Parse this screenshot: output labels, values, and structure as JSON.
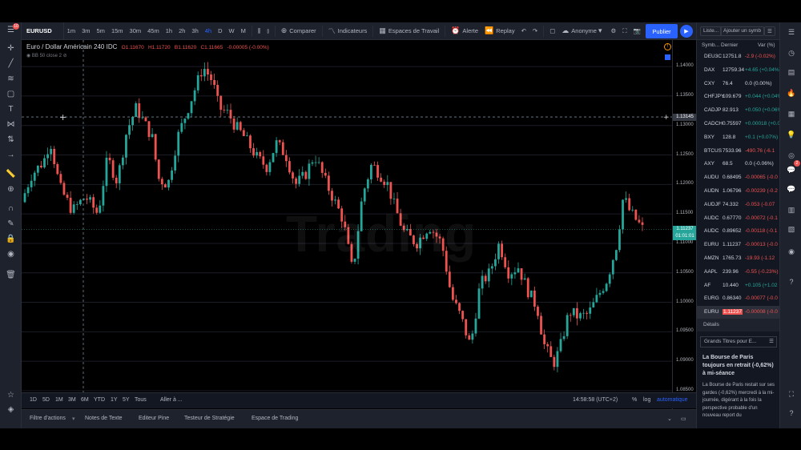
{
  "toolbar": {
    "symbol": "EURUSD",
    "intervals": [
      "1m",
      "3m",
      "5m",
      "15m",
      "30m",
      "45m",
      "1h",
      "2h",
      "3h",
      "4h",
      "D",
      "W",
      "M"
    ],
    "active_interval": "4h",
    "compare": "Comparer",
    "indicators": "Indicateurs",
    "workspaces": "Espaces de Travail",
    "alert": "Alerte",
    "replay": "Replay",
    "account": "Anonyme",
    "publish": "Publier"
  },
  "legend": {
    "title": "Euro / Dollar Américain  240  IDC",
    "open": "O1.11670",
    "high": "H1.11720",
    "low": "B1.11620",
    "close": "C1.11665",
    "change": "-0.00005 (-0.00%)",
    "indicator": "BB  50 close 2"
  },
  "watermark": "Trading",
  "price_axis": {
    "ticks": [
      "1.14000",
      "1.13500",
      "1.13000",
      "1.12500",
      "1.12000",
      "1.11500",
      "1.11000",
      "1.10500",
      "1.10000",
      "1.09500",
      "1.09000",
      "1.08500"
    ],
    "crosshair_price": "1.13145",
    "last_price": "1.11237",
    "countdown": "01:01:01"
  },
  "time_axis": {
    "ticks": [
      "13",
      "Juin",
      "17",
      "Juill",
      "15",
      "12:00",
      "Août",
      "12",
      "21",
      "Sept",
      "16",
      "Oct",
      "14",
      "23"
    ],
    "crosshair_time": "20 Mai '19  20:00"
  },
  "bottom": {
    "ranges": [
      "1D",
      "5D",
      "1M",
      "3M",
      "6M",
      "YTD",
      "1Y",
      "5Y",
      "Tous"
    ],
    "goto": "Aller à ...",
    "clock": "14:58:58 (UTC+2)",
    "percent": "%",
    "log": "log",
    "auto": "automatique"
  },
  "panels": [
    "Filtre d'actions",
    "Notes de Texte",
    "Editeur Pine",
    "Testeur de Stratégie",
    "Espace de Trading"
  ],
  "watchlist": {
    "tab1": "Liste...",
    "tab2": "Ajouter un symb",
    "col_symbol": "Symb...",
    "col_last": "Dernier",
    "col_chg": "Var (%)",
    "rows": [
      {
        "sym": "DEU3C",
        "last": "12751.8",
        "chg": "-2.9 (-0.02%)",
        "dir": "dn"
      },
      {
        "sym": "DAX",
        "last": "12759.34",
        "chg": "+4.65 (+0.04%)",
        "dir": "up"
      },
      {
        "sym": "CXY",
        "last": "76.4",
        "chg": "0.0 (0.00%)",
        "dir": "neu"
      },
      {
        "sym": "CHFJPY",
        "last": "109.679",
        "chg": "+0.044 (+0.04%)",
        "dir": "up"
      },
      {
        "sym": "CADJP",
        "last": "82.913",
        "chg": "+0.050 (+0.06%)",
        "dir": "up"
      },
      {
        "sym": "CADCH",
        "last": "0.75597",
        "chg": "+0.00018 (+0.0",
        "dir": "up"
      },
      {
        "sym": "BXY",
        "last": "128.8",
        "chg": "+0.1 (+0.07%)",
        "dir": "up"
      },
      {
        "sym": "BTCUS",
        "last": "7533.96",
        "chg": "-490.76 (-6.1",
        "dir": "dn"
      },
      {
        "sym": "AXY",
        "last": "68.5",
        "chg": "0.0 (-0.06%)",
        "dir": "neu"
      },
      {
        "sym": "AUDU",
        "last": "0.68495",
        "chg": "-0.00065 (-0.0",
        "dir": "dn"
      },
      {
        "sym": "AUDN",
        "last": "1.06796",
        "chg": "-0.00239 (-0.2",
        "dir": "dn"
      },
      {
        "sym": "AUDJF",
        "last": "74.332",
        "chg": "-0.053 (-0.07",
        "dir": "dn"
      },
      {
        "sym": "AUDC",
        "last": "0.67770",
        "chg": "-0.00072 (-0.1",
        "dir": "dn"
      },
      {
        "sym": "AUDC",
        "last": "0.89652",
        "chg": "-0.00118 (-0.1",
        "dir": "dn"
      },
      {
        "sym": "EURU",
        "last": "1.11237",
        "chg": "-0.00013 (-0.0",
        "dir": "dn"
      },
      {
        "sym": "AMZN",
        "last": "1765.73",
        "chg": "-19.93 (-1.12",
        "dir": "dn"
      },
      {
        "sym": "AAPL",
        "last": "239.96",
        "chg": "-0.55 (-0.23%)",
        "dir": "dn"
      },
      {
        "sym": "AF",
        "last": "10.440",
        "chg": "+0.105 (+1.02",
        "dir": "up"
      },
      {
        "sym": "EURG",
        "last": "0.86340",
        "chg": "-0.00077 (-0.0",
        "dir": "dn"
      },
      {
        "sym": "EURU",
        "last": "1.11237",
        "chg": "-0.00008 (-0.0",
        "dir": "dn"
      }
    ],
    "details": "Détails",
    "news_header": "Grands Titres pour E...",
    "news_title": "La Bourse de Paris toujours en retrait (-0,62%) à mi-séance",
    "news_body": "La Bourse de Paris restait sur ses gardes (-0,62%) mercredi à la mi-journée, digérant à la fois la perspective probable d'un nouveau report du"
  },
  "right_badge": "2",
  "notif_badge": "10",
  "colors": {
    "up": "#26a69a",
    "down": "#ef5350",
    "accent": "#2962ff",
    "background": "#000000"
  },
  "chart_data": {
    "type": "candlestick",
    "symbol": "EURUSD",
    "interval": "240",
    "ylim": [
      1.0835,
      1.1445
    ],
    "path": [
      [
        0,
        1.117
      ],
      [
        0.015,
        1.1215
      ],
      [
        0.035,
        1.124
      ],
      [
        0.045,
        1.1275
      ],
      [
        0.06,
        1.1195
      ],
      [
        0.08,
        1.1155
      ],
      [
        0.1,
        1.118
      ],
      [
        0.12,
        1.115
      ],
      [
        0.135,
        1.1245
      ],
      [
        0.15,
        1.1205
      ],
      [
        0.165,
        1.129
      ],
      [
        0.18,
        1.133
      ],
      [
        0.195,
        1.13
      ],
      [
        0.205,
        1.128
      ],
      [
        0.215,
        1.121
      ],
      [
        0.23,
        1.12
      ],
      [
        0.245,
        1.128
      ],
      [
        0.265,
        1.134
      ],
      [
        0.285,
        1.14
      ],
      [
        0.3,
        1.1375
      ],
      [
        0.31,
        1.133
      ],
      [
        0.325,
        1.132
      ],
      [
        0.335,
        1.13
      ],
      [
        0.35,
        1.128
      ],
      [
        0.37,
        1.1245
      ],
      [
        0.385,
        1.123
      ],
      [
        0.4,
        1.127
      ],
      [
        0.415,
        1.125
      ],
      [
        0.43,
        1.12
      ],
      [
        0.445,
        1.1215
      ],
      [
        0.46,
        1.125
      ],
      [
        0.475,
        1.121
      ],
      [
        0.49,
        1.1175
      ],
      [
        0.505,
        1.114
      ],
      [
        0.52,
        1.105
      ],
      [
        0.535,
        1.118
      ],
      [
        0.55,
        1.1235
      ],
      [
        0.565,
        1.1215
      ],
      [
        0.575,
        1.12
      ],
      [
        0.585,
        1.1165
      ],
      [
        0.6,
        1.112
      ],
      [
        0.62,
        1.11
      ],
      [
        0.64,
        1.113
      ],
      [
        0.66,
        1.11
      ],
      [
        0.675,
        1.101
      ],
      [
        0.69,
        1.0975
      ],
      [
        0.705,
        1.0925
      ],
      [
        0.72,
        1.103
      ],
      [
        0.735,
        1.105
      ],
      [
        0.75,
        1.11
      ],
      [
        0.765,
        1.105
      ],
      [
        0.78,
        1.106
      ],
      [
        0.795,
        1.102
      ],
      [
        0.81,
        1.099
      ],
      [
        0.82,
        1.093
      ],
      [
        0.835,
        1.0895
      ],
      [
        0.845,
        1.092
      ],
      [
        0.86,
        1.0985
      ],
      [
        0.875,
        1.0975
      ],
      [
        0.89,
        1.098
      ],
      [
        0.905,
        1.101
      ],
      [
        0.92,
        1.104
      ],
      [
        0.935,
        1.11
      ],
      [
        0.945,
        1.118
      ],
      [
        0.955,
        1.1155
      ],
      [
        0.965,
        1.114
      ],
      [
        0.975,
        1.1125
      ]
    ],
    "note": "Path gives approximate close trajectory; position along time axis from 0 to 1.",
    "last": 1.11237,
    "crosshair_price": 1.13145
  }
}
